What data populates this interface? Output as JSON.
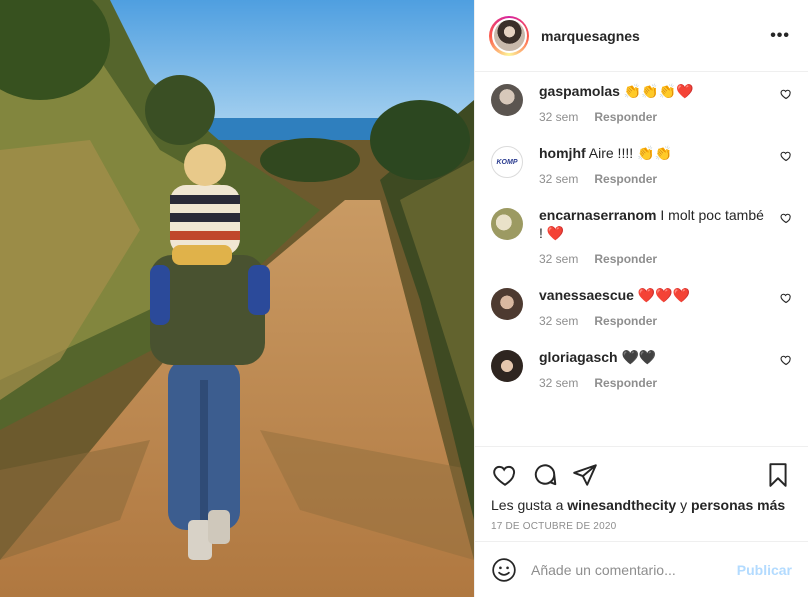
{
  "header": {
    "username": "marquesagnes",
    "more_label": "•••"
  },
  "comments": [
    {
      "user": "gaspamolas",
      "text": " 👏👏👏❤️",
      "time": "32 sem",
      "reply": "Responder",
      "avatar": "avatar-gaspamolas"
    },
    {
      "user": "homjhf",
      "text": " Aire !!!! 👏👏",
      "time": "32 sem",
      "reply": "Responder",
      "avatar": "avatar-homjhf"
    },
    {
      "user": "encarnaserranom",
      "text": " I molt poc també ! ❤️",
      "time": "32 sem",
      "reply": "Responder",
      "avatar": "avatar-encarnaserranom"
    },
    {
      "user": "vanessaescue",
      "text": " ❤️❤️❤️",
      "time": "32 sem",
      "reply": "Responder",
      "avatar": "avatar-vanessaescue"
    },
    {
      "user": "gloriagasch",
      "text": " 🖤🖤",
      "time": "32 sem",
      "reply": "Responder",
      "avatar": "avatar-gloriagasch"
    }
  ],
  "likes": {
    "prefix": "Les gusta a ",
    "user": "winesandthecity",
    "conj": " y ",
    "others": "personas más"
  },
  "date": "17 de octubre de 2020",
  "composer": {
    "placeholder": "Añade un comentario...",
    "publish_label": "Publicar"
  },
  "icons": [
    "heart-icon",
    "comment-icon",
    "share-icon",
    "bookmark-icon",
    "smiley-icon"
  ]
}
